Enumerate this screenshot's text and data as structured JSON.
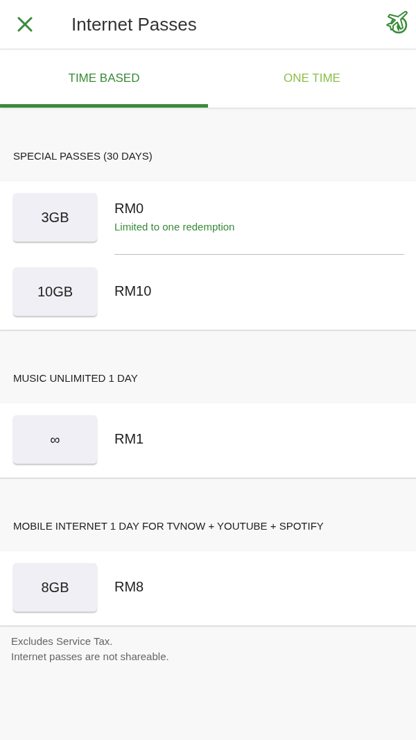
{
  "app_bar": {
    "title": "Internet Passes"
  },
  "tabs": [
    {
      "label": "TIME BASED",
      "selected": true
    },
    {
      "label": "ONE TIME",
      "selected": false
    }
  ],
  "sections": [
    {
      "header": "SPECIAL PASSES (30 DAYS)",
      "passes": [
        {
          "quota": "3GB",
          "price": "RM0",
          "note": "Limited to one redemption"
        },
        {
          "quota": "10GB",
          "price": "RM10"
        }
      ]
    },
    {
      "header": "MUSIC UNLIMITED 1 DAY",
      "passes": [
        {
          "quota": "∞",
          "price": "RM1"
        }
      ]
    },
    {
      "header": "MOBILE INTERNET 1 DAY FOR TVNOW + YOUTUBE + SPOTIFY",
      "passes": [
        {
          "quota": "8GB",
          "price": "RM8"
        }
      ]
    }
  ],
  "footnotes": [
    "Excludes Service Tax.",
    "Internet passes are not shareable."
  ]
}
